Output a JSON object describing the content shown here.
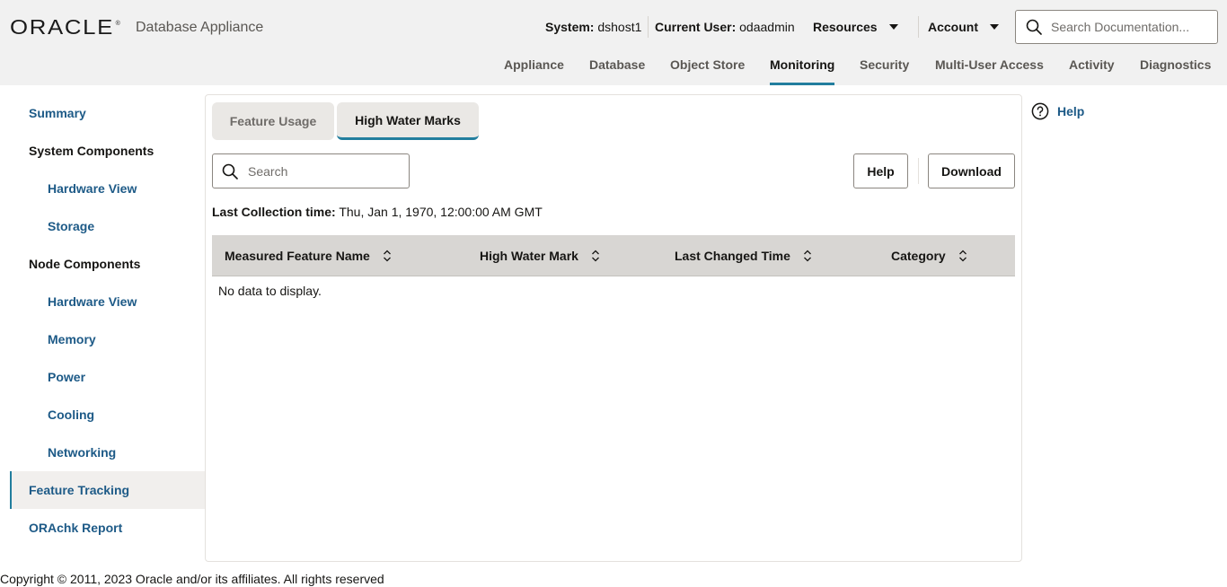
{
  "header": {
    "logo_text": "ORACLE",
    "logo_mark": "®",
    "app_name": "Database Appliance",
    "system_label": "System:",
    "system_value": "dshost1",
    "user_label": "Current User:",
    "user_value": "odaadmin",
    "resources_label": "Resources",
    "account_label": "Account",
    "doc_search_placeholder": "Search Documentation..."
  },
  "topnav": {
    "items": [
      {
        "label": "Appliance"
      },
      {
        "label": "Database"
      },
      {
        "label": "Object Store"
      },
      {
        "label": "Monitoring",
        "active": true
      },
      {
        "label": "Security"
      },
      {
        "label": "Multi-User Access"
      },
      {
        "label": "Activity"
      },
      {
        "label": "Diagnostics"
      }
    ]
  },
  "sidebar": {
    "items": [
      {
        "label": "Summary"
      },
      {
        "label": "System Components"
      },
      {
        "label": "Hardware View"
      },
      {
        "label": "Storage"
      },
      {
        "label": "Node Components"
      },
      {
        "label": "Hardware View"
      },
      {
        "label": "Memory"
      },
      {
        "label": "Power"
      },
      {
        "label": "Cooling"
      },
      {
        "label": "Networking"
      },
      {
        "label": "Feature Tracking",
        "active": true
      },
      {
        "label": "ORAchk Report"
      }
    ]
  },
  "tabs": [
    {
      "label": "Feature Usage"
    },
    {
      "label": "High Water Marks",
      "selected": true
    }
  ],
  "toolbar": {
    "search_placeholder": "Search",
    "help_label": "Help",
    "download_label": "Download"
  },
  "collection": {
    "label": "Last Collection time:",
    "value": "Thu, Jan 1, 1970, 12:00:00 AM GMT"
  },
  "table": {
    "columns": [
      {
        "label": "Measured Feature Name"
      },
      {
        "label": "High Water Mark"
      },
      {
        "label": "Last Changed Time"
      },
      {
        "label": "Category"
      }
    ],
    "empty_text": "No data to display."
  },
  "side_help": {
    "label": "Help"
  },
  "footer": {
    "text": "Copyright © 2011, 2023 Oracle and/or its affiliates. All rights reserved"
  },
  "colors": {
    "accent": "#227e9e",
    "link": "#1d5a87",
    "header_bg": "#f1f1f1",
    "table_header_bg": "#d8d6d3"
  },
  "icons": {
    "search": "search-icon",
    "caret": "caret-down-icon",
    "sort": "sort-icon",
    "help": "help-circle-icon"
  }
}
